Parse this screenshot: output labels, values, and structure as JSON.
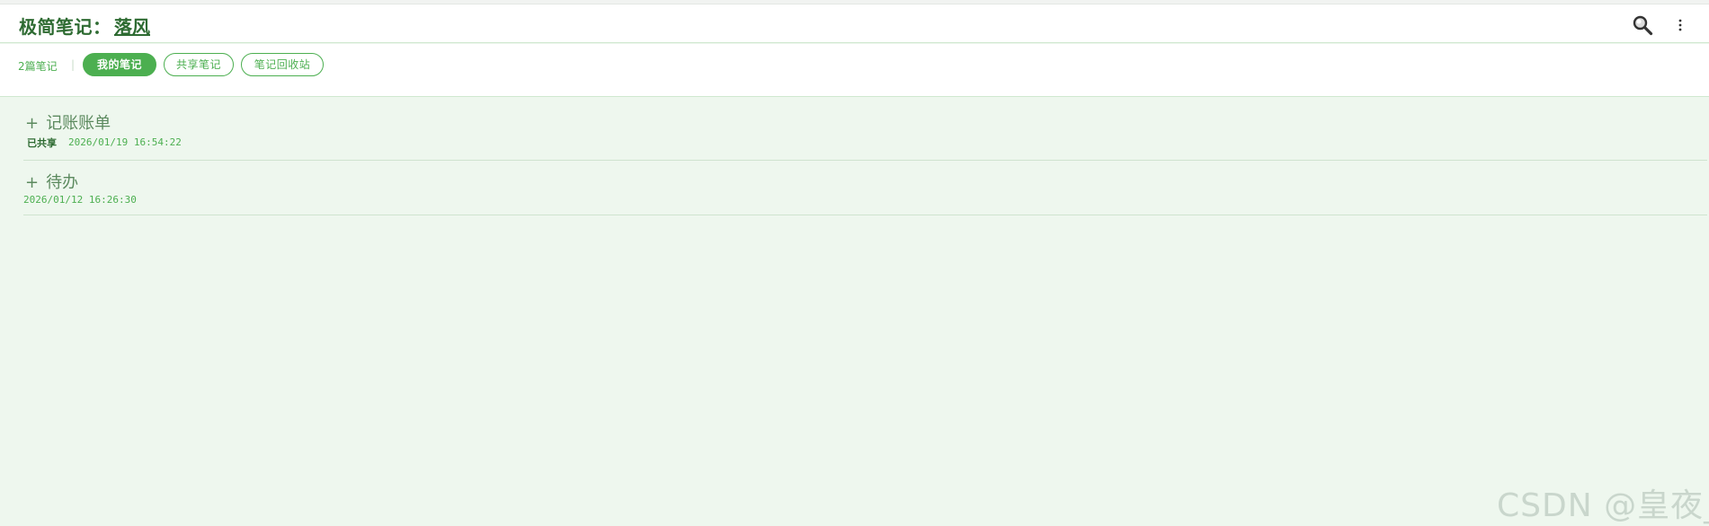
{
  "header": {
    "app_title": "极简笔记：",
    "username": "落风",
    "search_icon": "search-icon",
    "more_icon": "more-vertical-icon"
  },
  "toolbar": {
    "note_count": "2篇笔记",
    "separator": "|",
    "tabs": [
      {
        "label": "我的笔记",
        "active": true
      },
      {
        "label": "共享笔记",
        "active": false
      },
      {
        "label": "笔记回收站",
        "active": false
      }
    ]
  },
  "notes": [
    {
      "expander": "+",
      "title": "记账账单",
      "shared_label": "已共享",
      "timestamp": "2026/01/19 16:54:22"
    },
    {
      "expander": "+",
      "title": "待办",
      "timestamp": "2026/01/12 16:26:30"
    }
  ],
  "watermark": "CSDN @皇夜_",
  "colors": {
    "accent": "#4caf50",
    "dark_green": "#2e6b32",
    "background": "#eef7ee"
  }
}
